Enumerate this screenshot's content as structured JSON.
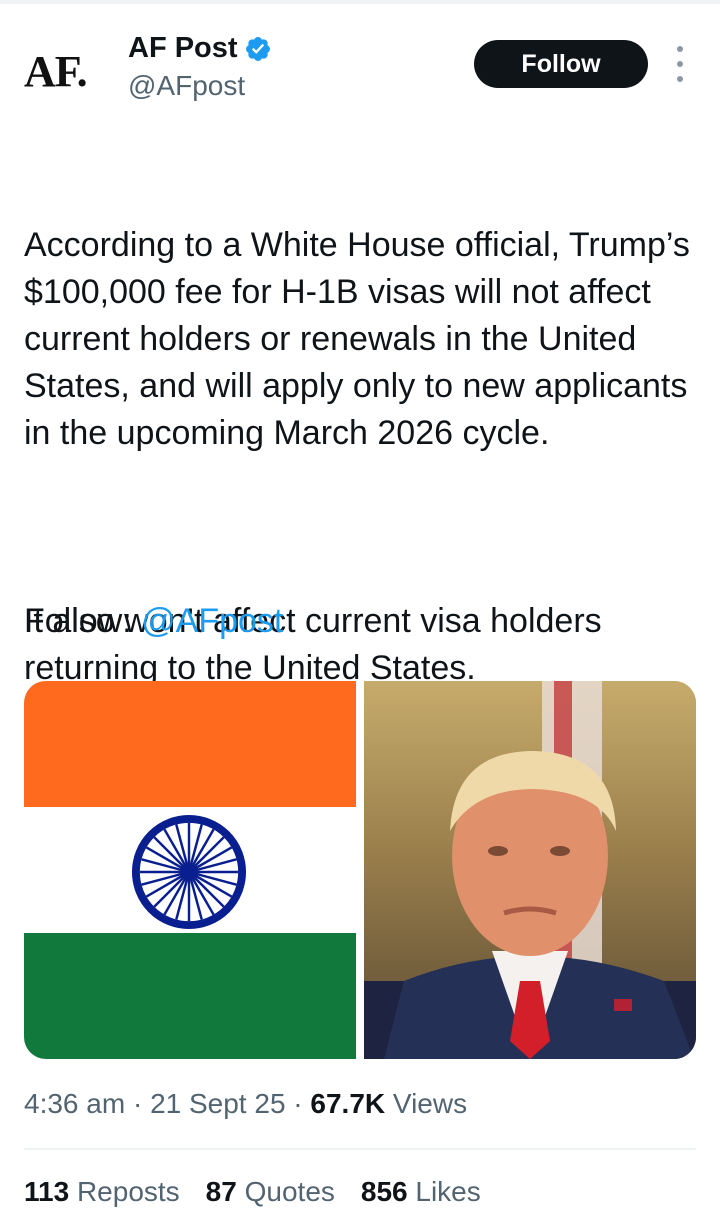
{
  "author": {
    "avatar_text": "AF.",
    "display_name": "AF Post",
    "handle": "@AFpost"
  },
  "actions": {
    "follow_label": "Follow"
  },
  "tweet": {
    "paragraph1": "According to a White House official, Trump’s $100,000 fee for H-1B visas will not affect current holders or renewals in the United States, and will apply only to new applicants in the upcoming March 2026 cycle.",
    "paragraph2": "It also won’t affect current visa holders returning to the United States.",
    "follow_prefix": "Follow: ",
    "follow_mention": "@AFpost"
  },
  "meta": {
    "time": "4:36 am",
    "date": "21 Sept 25",
    "views_count": "67.7K",
    "views_label": "Views",
    "separator": "·"
  },
  "stats": {
    "reposts_count": "113",
    "reposts_label": "Reposts",
    "quotes_count": "87",
    "quotes_label": "Quotes",
    "likes_count": "856",
    "likes_label": "Likes"
  },
  "colors": {
    "accent": "#1d9bf0",
    "flag_saffron": "#ff6a1f",
    "flag_green": "#11793b",
    "chakra_blue": "#0a1f8f"
  }
}
